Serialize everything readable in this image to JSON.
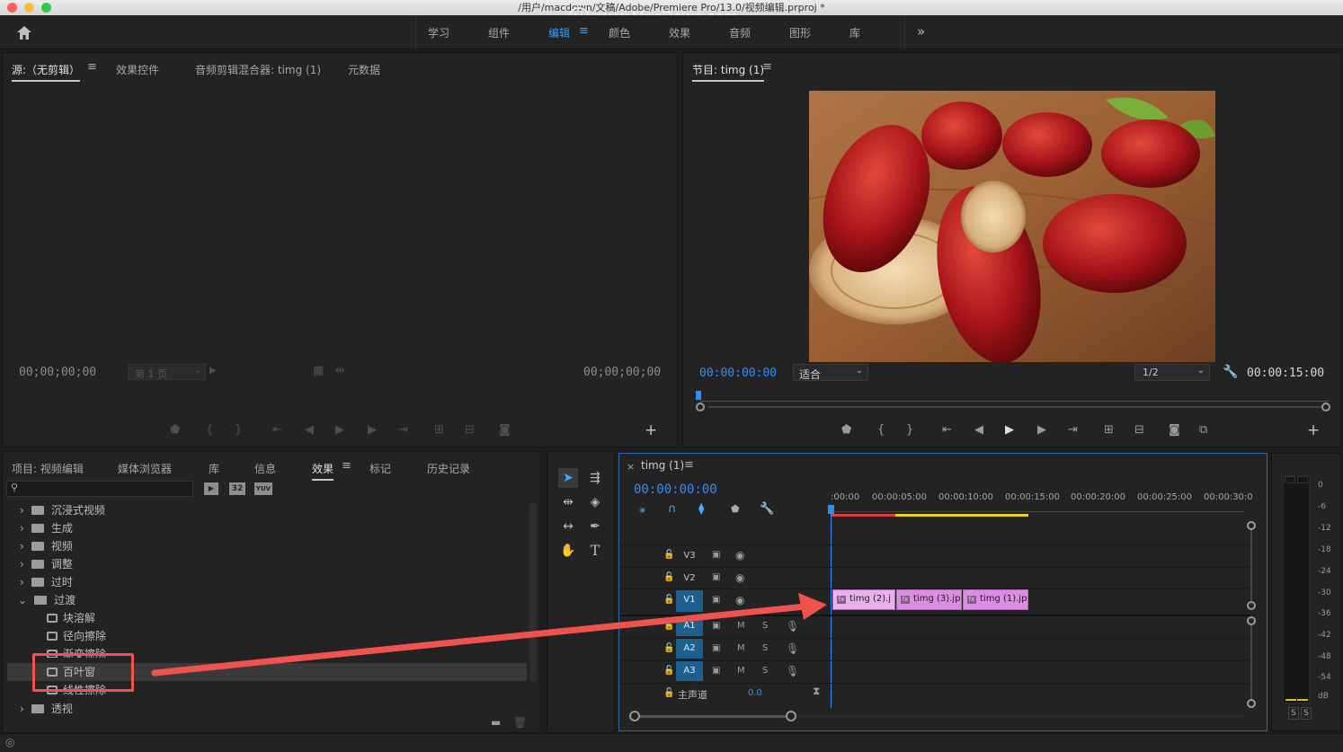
{
  "window_title": "/用户/macdown/文稿/Adobe/Premiere Pro/13.0/视频编辑.prproj *",
  "watermark": "www.MacDown.com",
  "workspaces": [
    {
      "label": "学习",
      "active": false
    },
    {
      "label": "组件",
      "active": false
    },
    {
      "label": "编辑",
      "active": true
    },
    {
      "label": "颜色",
      "active": false
    },
    {
      "label": "效果",
      "active": false
    },
    {
      "label": "音频",
      "active": false
    },
    {
      "label": "图形",
      "active": false
    },
    {
      "label": "库",
      "active": false
    }
  ],
  "source_panel": {
    "tabs": [
      "源:（无剪辑）",
      "效果控件",
      "音频剪辑混合器: timg (1)",
      "元数据"
    ],
    "timecode_left": "00;00;00;00",
    "timecode_right": "00;00;00;00",
    "page_select": "第 1 页"
  },
  "program_panel": {
    "tab": "节目: timg (1)",
    "timecode_current": "00:00:00:00",
    "fit_select": "适合",
    "resolution_select": "1/2",
    "timecode_duration": "00:00:15:00"
  },
  "project_panel": {
    "tabs": [
      "项目: 视频编辑",
      "媒体浏览器",
      "库",
      "信息",
      "效果",
      "标记",
      "历史记录"
    ],
    "active_tab": "效果",
    "badges": [
      "32",
      "YUV"
    ],
    "tree": [
      {
        "label": "沉浸式视频",
        "type": "folder",
        "expanded": false,
        "depth": 0
      },
      {
        "label": "生成",
        "type": "folder",
        "expanded": false,
        "depth": 0
      },
      {
        "label": "视频",
        "type": "folder",
        "expanded": false,
        "depth": 0
      },
      {
        "label": "调整",
        "type": "folder",
        "expanded": false,
        "depth": 0
      },
      {
        "label": "过时",
        "type": "folder",
        "expanded": false,
        "depth": 0
      },
      {
        "label": "过渡",
        "type": "folder",
        "expanded": true,
        "depth": 0
      },
      {
        "label": "块溶解",
        "type": "effect",
        "depth": 1
      },
      {
        "label": "径向擦除",
        "type": "effect",
        "depth": 1
      },
      {
        "label": "渐变擦除",
        "type": "effect",
        "depth": 1
      },
      {
        "label": "百叶窗",
        "type": "effect",
        "depth": 1,
        "selected": true
      },
      {
        "label": "线性擦除",
        "type": "effect",
        "depth": 1
      },
      {
        "label": "透视",
        "type": "folder",
        "expanded": false,
        "depth": 0
      }
    ]
  },
  "timeline": {
    "tab": "timg (1)",
    "timecode": "00:00:00:00",
    "ruler": [
      ":00:00",
      "00:00:05:00",
      "00:00:10:00",
      "00:00:15:00",
      "00:00:20:00",
      "00:00:25:00",
      "00:00:30:0"
    ],
    "video_tracks": [
      "V3",
      "V2",
      "V1"
    ],
    "audio_tracks": [
      "A1",
      "A2",
      "A3"
    ],
    "master_label": "主声道",
    "master_value": "0.0",
    "mute_label": "M",
    "solo_label": "S",
    "clips": [
      {
        "name": "timg (2).j",
        "badge": "fx"
      },
      {
        "name": "timg (3).jp",
        "badge": "fx"
      },
      {
        "name": "timg (1).jp",
        "badge": "fx"
      }
    ]
  },
  "audio_meter": {
    "labels": [
      "0",
      "-6",
      "-12",
      "-18",
      "-24",
      "-30",
      "-36",
      "-42",
      "-48",
      "-54",
      "dB"
    ],
    "solo_buttons": [
      "S",
      "S"
    ]
  },
  "colors": {
    "accent": "#2f8ff0",
    "clip": "#d98ee0",
    "arrow": "#ef5350",
    "highlight_box": "#ef5350"
  }
}
